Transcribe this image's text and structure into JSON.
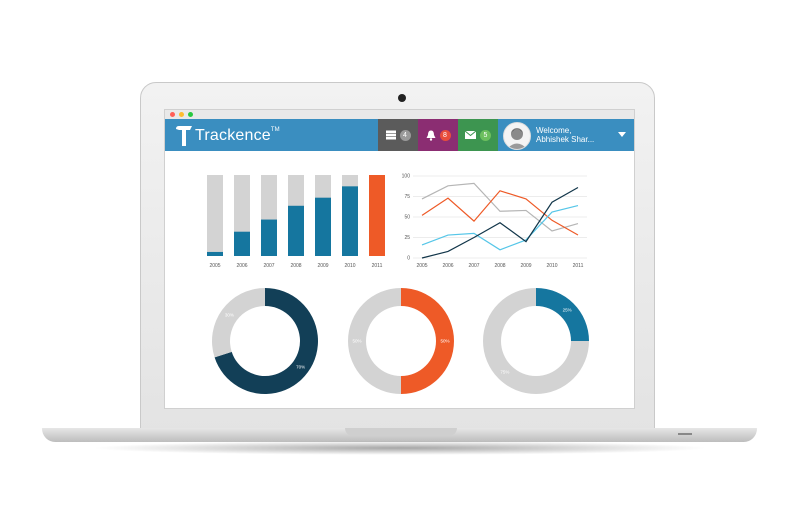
{
  "app": {
    "logo_text": "Trackence",
    "logo_tm": "TM",
    "brand_color": "#3a8ec0"
  },
  "window_controls": {
    "colors": [
      "#ff5f57",
      "#febc2e",
      "#28c840"
    ]
  },
  "header": {
    "buttons": [
      {
        "icon": "server-icon",
        "count": "4",
        "bg": "#5b5b5b",
        "badge_bg": "#9a9a9a"
      },
      {
        "icon": "bell-icon",
        "count": "8",
        "bg": "#8b2d72",
        "badge_bg": "#e84d3c"
      },
      {
        "icon": "envelope-icon",
        "count": "5",
        "bg": "#3d9550",
        "badge_bg": "#6cbf5e"
      }
    ],
    "user": {
      "greeting": "Welcome,",
      "name": "Abhishek Shar..."
    }
  },
  "chart_data": [
    {
      "type": "bar",
      "categories": [
        "2005",
        "2006",
        "2007",
        "2008",
        "2009",
        "2010",
        "2011"
      ],
      "series": [
        {
          "values": [
            5,
            30,
            45,
            62,
            72,
            86,
            100
          ],
          "color": "#15769f"
        }
      ],
      "background_color": "#d3d3d3",
      "highlight": {
        "index": 6,
        "color": "#ee5a27"
      },
      "ylim": [
        0,
        100
      ]
    },
    {
      "type": "line",
      "x": [
        "2005",
        "2006",
        "2007",
        "2008",
        "2009",
        "2010",
        "2011"
      ],
      "yticks": [
        "0",
        "25",
        "50",
        "75",
        "100"
      ],
      "ylim": [
        0,
        100
      ],
      "grid": true,
      "series": [
        {
          "color": "#b5b5b5",
          "values": [
            72,
            88,
            91,
            57,
            58,
            33,
            42
          ]
        },
        {
          "color": "#ee5a27",
          "values": [
            52,
            73,
            45,
            82,
            72,
            46,
            28
          ]
        },
        {
          "color": "#55c6e8",
          "values": [
            16,
            28,
            30,
            10,
            22,
            56,
            64
          ]
        },
        {
          "color": "#12364a",
          "values": [
            0,
            8,
            25,
            43,
            20,
            68,
            86
          ]
        }
      ]
    },
    {
      "type": "pie",
      "slices": [
        {
          "label": "70%",
          "value": 70,
          "color": "#123f57"
        },
        {
          "label": "30%",
          "value": 30,
          "color": "#d3d3d3"
        }
      ]
    },
    {
      "type": "pie",
      "slices": [
        {
          "label": "50%",
          "value": 50,
          "color": "#ee5a27"
        },
        {
          "label": "50%",
          "value": 50,
          "color": "#d3d3d3"
        }
      ]
    },
    {
      "type": "pie",
      "slices": [
        {
          "label": "25%",
          "value": 25,
          "color": "#15769f"
        },
        {
          "label": "75%",
          "value": 75,
          "color": "#d3d3d3"
        }
      ]
    }
  ]
}
